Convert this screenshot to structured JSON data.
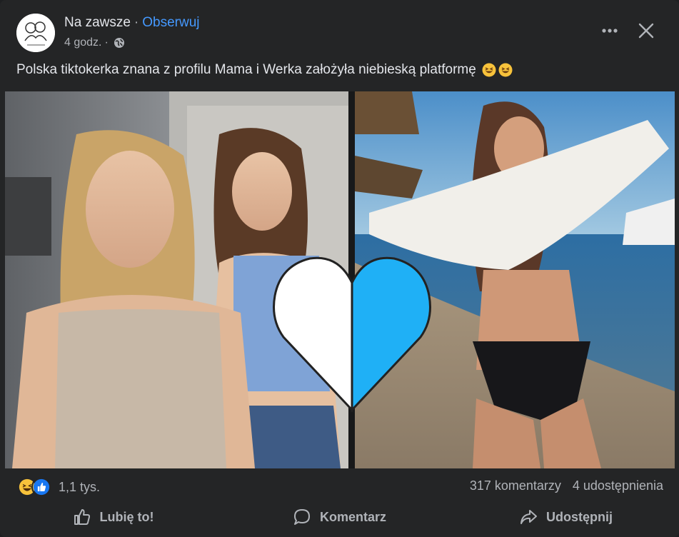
{
  "post": {
    "page_name": "Na zawsze",
    "separator": "·",
    "follow_label": "Obserwuj",
    "time": "4 godz.",
    "dot": "·",
    "visibility_icon": "globe-icon",
    "caption": "Polska tiktokerka znana z profilu Mama i Werka założyła niebieską platformę",
    "caption_emojis": [
      "laughing-emoji",
      "laughing-emoji"
    ]
  },
  "header_controls": {
    "more_icon": "more-options-icon",
    "close_icon": "close-icon"
  },
  "media": {
    "overlay_icon": "white-blue-heart"
  },
  "engagement": {
    "reaction_icons": [
      "haha-reaction-icon",
      "like-reaction-icon"
    ],
    "reaction_count": "1,1 tys.",
    "comments": "317 komentarzy",
    "shares": "4 udostępnienia"
  },
  "actions": {
    "like_label": "Lubię to!",
    "comment_label": "Komentarz",
    "share_label": "Udostępnij"
  },
  "colors": {
    "background": "#242526",
    "text_primary": "#e4e6eb",
    "text_secondary": "#b0b3b8",
    "link_blue": "#4599ff",
    "heart_blue": "#1fb0f6"
  }
}
